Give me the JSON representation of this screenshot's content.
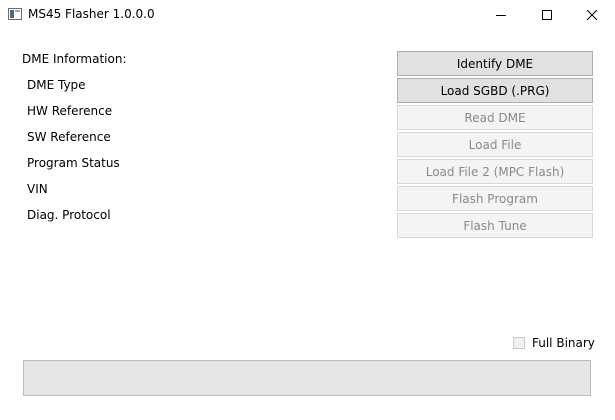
{
  "window": {
    "title": "MS45 Flasher 1.0.0.0",
    "icons": [
      "app-icon",
      "minimize-icon",
      "maximize-icon",
      "close-icon"
    ]
  },
  "info": {
    "header": "DME Information:",
    "labels": [
      "DME Type",
      "HW Reference",
      "SW Reference",
      "Program Status",
      "VIN",
      "Diag. Protocol"
    ]
  },
  "buttons": {
    "identify_dme": "Identify DME",
    "load_sgbd": "Load SGBD (.PRG)",
    "read_dme": "Read DME",
    "load_file": "Load File",
    "load_file_2": "Load File 2 (MPC Flash)",
    "flash_program": "Flash Program",
    "flash_tune": "Flash Tune"
  },
  "options": {
    "full_binary_label": "Full Binary",
    "full_binary_checked": false
  },
  "progress": {
    "value": 0
  }
}
